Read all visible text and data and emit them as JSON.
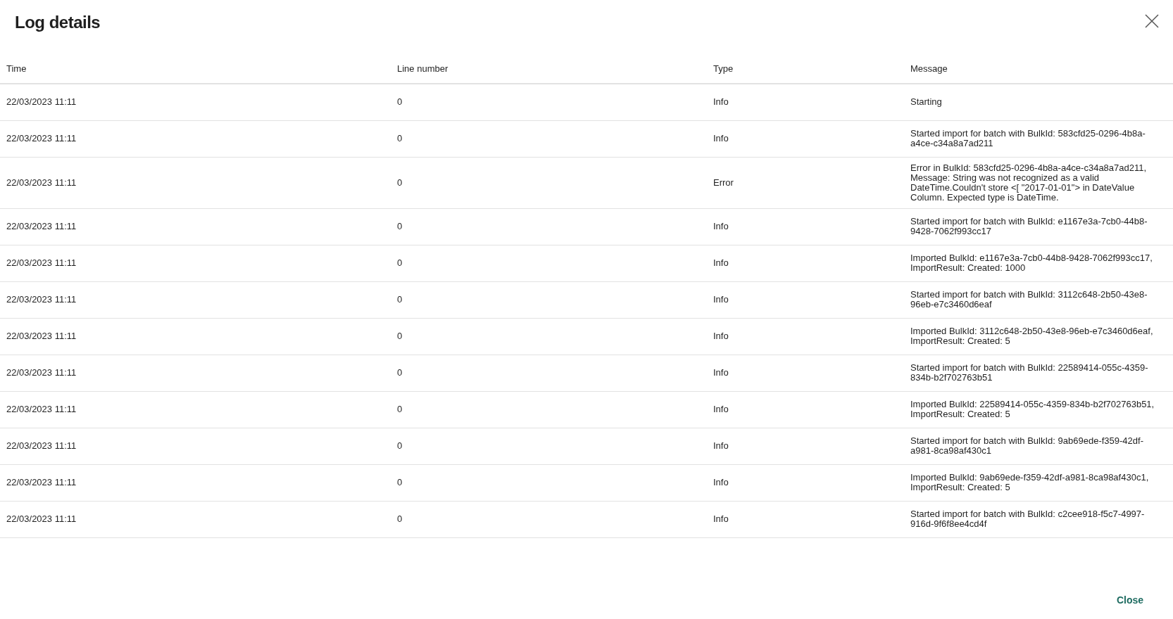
{
  "dialog": {
    "title": "Log details",
    "close_button": "Close"
  },
  "table": {
    "columns": [
      "Time",
      "Line number",
      "Type",
      "Message"
    ],
    "rows": [
      {
        "time": "22/03/2023 11:11",
        "line_number": "0",
        "type": "Info",
        "message": "Starting"
      },
      {
        "time": "22/03/2023 11:11",
        "line_number": "0",
        "type": "Info",
        "message": "Started import for batch with BulkId: 583cfd25-0296-4b8a-a4ce-c34a8a7ad211"
      },
      {
        "time": "22/03/2023 11:11",
        "line_number": "0",
        "type": "Error",
        "message": "Error in BulkId: 583cfd25-0296-4b8a-a4ce-c34a8a7ad211, Message: String was not recognized as a valid DateTime.Couldn't store <[ \"2017-01-01\"> in DateValue Column. Expected type is DateTime."
      },
      {
        "time": "22/03/2023 11:11",
        "line_number": "0",
        "type": "Info",
        "message": "Started import for batch with BulkId: e1167e3a-7cb0-44b8-9428-7062f993cc17"
      },
      {
        "time": "22/03/2023 11:11",
        "line_number": "0",
        "type": "Info",
        "message": "Imported BulkId: e1167e3a-7cb0-44b8-9428-7062f993cc17, ImportResult: Created: 1000"
      },
      {
        "time": "22/03/2023 11:11",
        "line_number": "0",
        "type": "Info",
        "message": "Started import for batch with BulkId: 3112c648-2b50-43e8-96eb-e7c3460d6eaf"
      },
      {
        "time": "22/03/2023 11:11",
        "line_number": "0",
        "type": "Info",
        "message": "Imported BulkId: 3112c648-2b50-43e8-96eb-e7c3460d6eaf, ImportResult: Created: 5"
      },
      {
        "time": "22/03/2023 11:11",
        "line_number": "0",
        "type": "Info",
        "message": "Started import for batch with BulkId: 22589414-055c-4359-834b-b2f702763b51"
      },
      {
        "time": "22/03/2023 11:11",
        "line_number": "0",
        "type": "Info",
        "message": "Imported BulkId: 22589414-055c-4359-834b-b2f702763b51, ImportResult: Created: 5"
      },
      {
        "time": "22/03/2023 11:11",
        "line_number": "0",
        "type": "Info",
        "message": "Started import for batch with BulkId: 9ab69ede-f359-42df-a981-8ca98af430c1"
      },
      {
        "time": "22/03/2023 11:11",
        "line_number": "0",
        "type": "Info",
        "message": "Imported BulkId: 9ab69ede-f359-42df-a981-8ca98af430c1, ImportResult: Created: 5"
      },
      {
        "time": "22/03/2023 11:11",
        "line_number": "0",
        "type": "Info",
        "message": "Started import for batch with BulkId: c2cee918-f5c7-4997-916d-9f6f8ee4cd4f"
      }
    ]
  }
}
